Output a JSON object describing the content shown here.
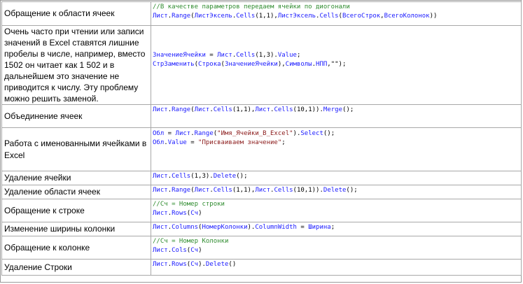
{
  "rows": [
    {
      "desc": "Обращение к области ячеек",
      "code": [
        [
          {
            "t": "//В качестве параметров передаем ячейки по диогонали",
            "c": "green"
          }
        ],
        [
          {
            "t": "Лист",
            "c": "blue"
          },
          {
            "t": ".",
            "c": "black"
          },
          {
            "t": "Range",
            "c": "blue"
          },
          {
            "t": "(",
            "c": "black"
          },
          {
            "t": "ЛистЭксель",
            "c": "blue"
          },
          {
            "t": ".",
            "c": "black"
          },
          {
            "t": "Cells",
            "c": "blue"
          },
          {
            "t": "(1,1),",
            "c": "black"
          },
          {
            "t": "ЛистЭксель",
            "c": "blue"
          },
          {
            "t": ".",
            "c": "black"
          },
          {
            "t": "Cells",
            "c": "blue"
          },
          {
            "t": "(",
            "c": "black"
          },
          {
            "t": "ВсегоСтрок",
            "c": "blue"
          },
          {
            "t": ",",
            "c": "black"
          },
          {
            "t": "ВсегоКолонок",
            "c": "blue"
          },
          {
            "t": "))",
            "c": "black"
          }
        ]
      ]
    },
    {
      "desc": "Очень часто при чтении или записи значений в Excel ставятся лишние пробелы в числе, например, вместо 1502 он читает как 1 502 и в дальнейшем это значение не приводится к числу. Эту проблему можно решить заменой.",
      "code": [
        [
          {
            "t": "ЗначениеЯчейки",
            "c": "blue"
          },
          {
            "t": " = ",
            "c": "black"
          },
          {
            "t": "Лист",
            "c": "blue"
          },
          {
            "t": ".",
            "c": "black"
          },
          {
            "t": "Cells",
            "c": "blue"
          },
          {
            "t": "(1,3).",
            "c": "black"
          },
          {
            "t": "Value",
            "c": "blue"
          },
          {
            "t": ";",
            "c": "black"
          }
        ],
        [
          {
            "t": "СтрЗаменить",
            "c": "blue"
          },
          {
            "t": "(",
            "c": "black"
          },
          {
            "t": "Строка",
            "c": "blue"
          },
          {
            "t": "(",
            "c": "black"
          },
          {
            "t": "ЗначениеЯчейки",
            "c": "blue"
          },
          {
            "t": "),",
            "c": "black"
          },
          {
            "t": "Символы",
            "c": "blue"
          },
          {
            "t": ".",
            "c": "black"
          },
          {
            "t": "НПП",
            "c": "blue"
          },
          {
            "t": ",\"\");",
            "c": "black"
          }
        ]
      ]
    },
    {
      "desc": "Объединение ячеек",
      "code": [
        [
          {
            "t": "Лист",
            "c": "blue"
          },
          {
            "t": ".",
            "c": "black"
          },
          {
            "t": "Range",
            "c": "blue"
          },
          {
            "t": "(",
            "c": "black"
          },
          {
            "t": "Лист",
            "c": "blue"
          },
          {
            "t": ".",
            "c": "black"
          },
          {
            "t": "Cells",
            "c": "blue"
          },
          {
            "t": "(1,1),",
            "c": "black"
          },
          {
            "t": "Лист",
            "c": "blue"
          },
          {
            "t": ".",
            "c": "black"
          },
          {
            "t": "Cells",
            "c": "blue"
          },
          {
            "t": "(10,1)).",
            "c": "black"
          },
          {
            "t": "Merge",
            "c": "blue"
          },
          {
            "t": "();",
            "c": "black"
          }
        ]
      ]
    },
    {
      "desc": "Работа с именованными ячейками в Excel",
      "code": [
        [
          {
            "t": "Обл",
            "c": "blue"
          },
          {
            "t": " = ",
            "c": "black"
          },
          {
            "t": "Лист",
            "c": "blue"
          },
          {
            "t": ".",
            "c": "black"
          },
          {
            "t": "Range",
            "c": "blue"
          },
          {
            "t": "(",
            "c": "black"
          },
          {
            "t": "\"Имя_Ячейки_В_Excel\"",
            "c": "str"
          },
          {
            "t": ").",
            "c": "black"
          },
          {
            "t": "Select",
            "c": "blue"
          },
          {
            "t": "();",
            "c": "black"
          }
        ],
        [
          {
            "t": "Обл",
            "c": "blue"
          },
          {
            "t": ".",
            "c": "black"
          },
          {
            "t": "Value",
            "c": "blue"
          },
          {
            "t": " = ",
            "c": "black"
          },
          {
            "t": "\"Присваиваем значение\"",
            "c": "str"
          },
          {
            "t": ";",
            "c": "black"
          }
        ]
      ]
    },
    {
      "desc": "Удаление ячейки",
      "code": [
        [
          {
            "t": "Лист",
            "c": "blue"
          },
          {
            "t": ".",
            "c": "black"
          },
          {
            "t": "Cells",
            "c": "blue"
          },
          {
            "t": "(1,3).",
            "c": "black"
          },
          {
            "t": "Delete",
            "c": "blue"
          },
          {
            "t": "();",
            "c": "black"
          }
        ]
      ]
    },
    {
      "desc": "Удаление области ячеек",
      "code": [
        [
          {
            "t": "Лист",
            "c": "blue"
          },
          {
            "t": ".",
            "c": "black"
          },
          {
            "t": "Range",
            "c": "blue"
          },
          {
            "t": "(",
            "c": "black"
          },
          {
            "t": "Лист",
            "c": "blue"
          },
          {
            "t": ".",
            "c": "black"
          },
          {
            "t": "Cells",
            "c": "blue"
          },
          {
            "t": "(1,1),",
            "c": "black"
          },
          {
            "t": "Лист",
            "c": "blue"
          },
          {
            "t": ".",
            "c": "black"
          },
          {
            "t": "Cells",
            "c": "blue"
          },
          {
            "t": "(10,1)).",
            "c": "black"
          },
          {
            "t": "Delete",
            "c": "blue"
          },
          {
            "t": "();",
            "c": "black"
          }
        ]
      ]
    },
    {
      "desc": "Обращение к строке",
      "code": [
        [
          {
            "t": "//Сч = Номер строки",
            "c": "green"
          }
        ],
        [
          {
            "t": "Лист",
            "c": "blue"
          },
          {
            "t": ".",
            "c": "black"
          },
          {
            "t": "Rows",
            "c": "blue"
          },
          {
            "t": "(",
            "c": "black"
          },
          {
            "t": "Сч",
            "c": "blue"
          },
          {
            "t": ")",
            "c": "black"
          }
        ]
      ]
    },
    {
      "desc": "Изменение ширины колонки",
      "code": [
        [
          {
            "t": "Лист",
            "c": "blue"
          },
          {
            "t": ".",
            "c": "black"
          },
          {
            "t": "Columns",
            "c": "blue"
          },
          {
            "t": "(",
            "c": "black"
          },
          {
            "t": "НомерКолонки",
            "c": "blue"
          },
          {
            "t": ").",
            "c": "black"
          },
          {
            "t": "ColumnWidth",
            "c": "blue"
          },
          {
            "t": " = ",
            "c": "black"
          },
          {
            "t": "Ширина",
            "c": "blue"
          },
          {
            "t": ";",
            "c": "black"
          }
        ]
      ]
    },
    {
      "desc": "Обращение к колонке",
      "code": [
        [
          {
            "t": "//Сч = Номер Колонки",
            "c": "green"
          }
        ],
        [
          {
            "t": "Лист",
            "c": "blue"
          },
          {
            "t": ".",
            "c": "black"
          },
          {
            "t": "Cols",
            "c": "blue"
          },
          {
            "t": "(",
            "c": "black"
          },
          {
            "t": "Сч",
            "c": "blue"
          },
          {
            "t": ")",
            "c": "black"
          }
        ]
      ]
    },
    {
      "desc": "Удаление Строки",
      "code": [
        [
          {
            "t": "Лист",
            "c": "blue"
          },
          {
            "t": ".",
            "c": "black"
          },
          {
            "t": "Rows",
            "c": "blue"
          },
          {
            "t": "(",
            "c": "black"
          },
          {
            "t": "Сч",
            "c": "blue"
          },
          {
            "t": ").",
            "c": "black"
          },
          {
            "t": "Delete",
            "c": "blue"
          },
          {
            "t": "()",
            "c": "black"
          }
        ]
      ]
    }
  ]
}
